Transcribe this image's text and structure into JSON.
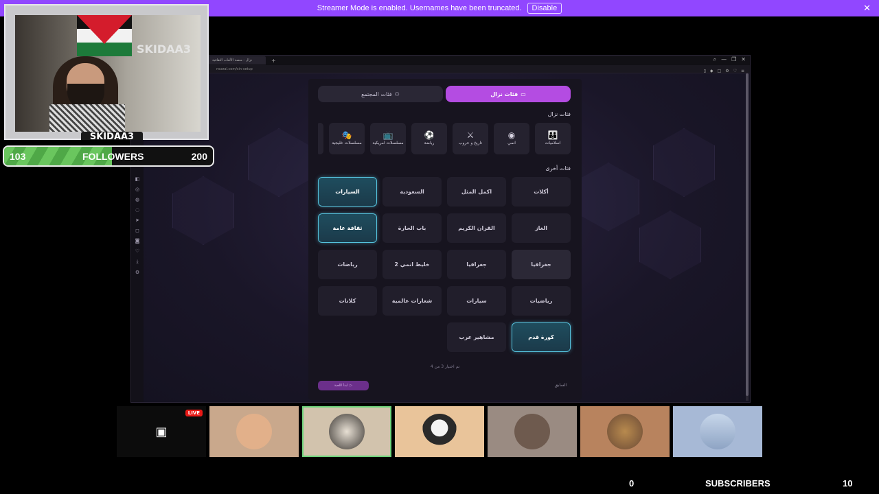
{
  "banner": {
    "message": "Streamer Mode is enabled. Usernames have been truncated.",
    "disable_label": "Disable",
    "close": "✕"
  },
  "browser": {
    "tab_title": "نزال - منصة الألعاب الثقافية",
    "url": "nezzal.com/sin-setup"
  },
  "panel": {
    "tabs": {
      "community": "فئات المجتمع",
      "nazal": "فئات نزال"
    },
    "nazal_section_title": "فئات نزال",
    "other_section_title": "فئات أخرى",
    "icon_categories": [
      {
        "label": "اسلاميات",
        "icon": "family-icon",
        "glyph": "👪"
      },
      {
        "label": "انمي",
        "icon": "anime-icon",
        "glyph": "◉"
      },
      {
        "label": "تاريخ و حروب",
        "icon": "swords-icon",
        "glyph": "⚔"
      },
      {
        "label": "رياضة",
        "icon": "ball-icon",
        "glyph": "⚽"
      },
      {
        "label": "مسلسلات امريكية",
        "icon": "tv-icon",
        "glyph": "📺"
      },
      {
        "label": "مسلسلات خليجية",
        "icon": "masks-icon",
        "glyph": "🎭"
      }
    ],
    "grid": [
      {
        "label": "أكلات",
        "state": "normal"
      },
      {
        "label": "اكمل المثل",
        "state": "normal"
      },
      {
        "label": "السعودية",
        "state": "normal"
      },
      {
        "label": "السيارات",
        "state": "selected"
      },
      {
        "label": "الغاز",
        "state": "normal"
      },
      {
        "label": "القران الكريم",
        "state": "normal"
      },
      {
        "label": "باب الحارة",
        "state": "normal"
      },
      {
        "label": "ثقافة عامة",
        "state": "selected"
      },
      {
        "label": "جغرافيا",
        "state": "hover"
      },
      {
        "label": "جغرافيا",
        "state": "normal"
      },
      {
        "label": "خليط انمي 2",
        "state": "normal"
      },
      {
        "label": "رياضات",
        "state": "normal"
      },
      {
        "label": "رياضيات",
        "state": "normal"
      },
      {
        "label": "سيارات",
        "state": "normal"
      },
      {
        "label": "شعارات عالمية",
        "state": "normal"
      },
      {
        "label": "كلانات",
        "state": "normal"
      },
      {
        "label": "كورة قدم",
        "state": "selected"
      },
      {
        "label": "مشاهير عرب",
        "state": "normal"
      }
    ],
    "selected_count_note": "تم اختيار 3 من 4",
    "start_label": "ابدأ اللعبة",
    "prev_label": "السابق"
  },
  "overlay": {
    "cam_name": "SKIDAA3",
    "wall_text": "SKIDAA3",
    "followers_current": "103",
    "followers_label": "FOLLOWERS",
    "followers_goal": "200",
    "followers_progress": 0.515
  },
  "bottom": {
    "live_badge": "LIVE",
    "subscribers_current": "0",
    "subscribers_label": "SUBSCRIBERS",
    "subscribers_goal": "10"
  },
  "colors": {
    "banner": "#9147ff",
    "accent_purple": "#b44ce2",
    "selected_cyan": "#56c3de",
    "live_red": "#e91916"
  }
}
